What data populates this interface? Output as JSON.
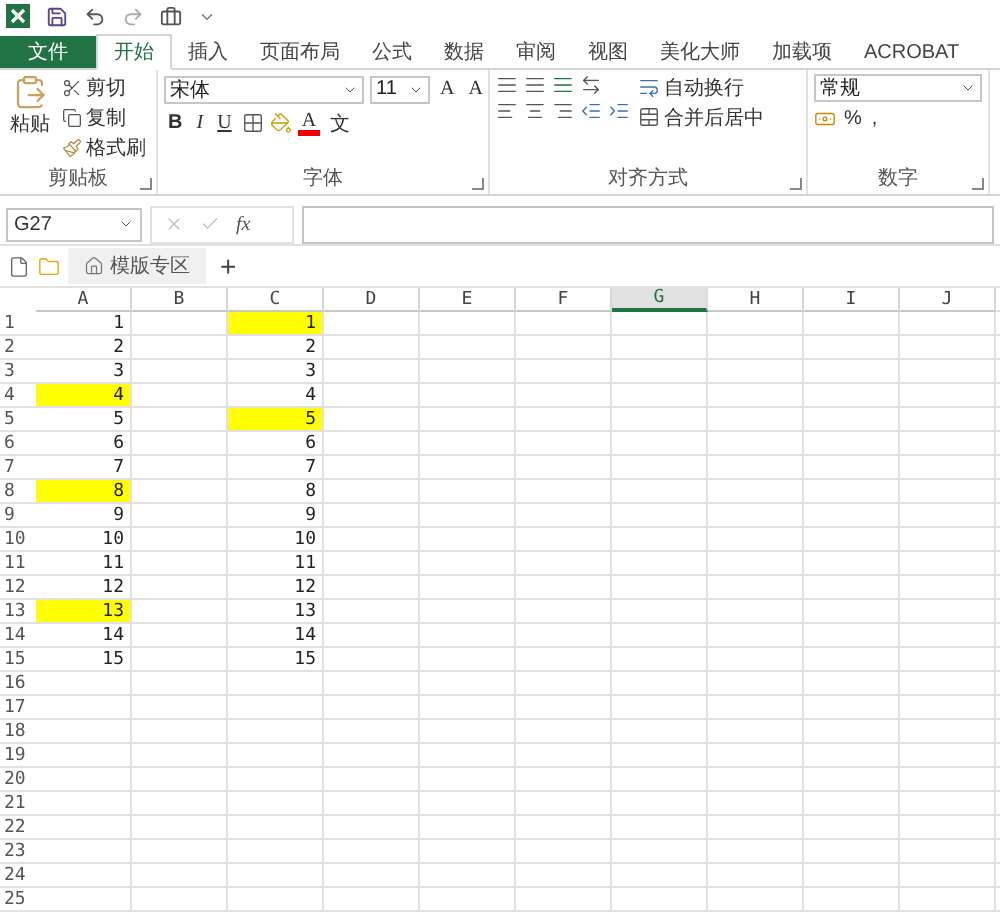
{
  "ribbon_tabs": [
    {
      "label": "文件",
      "kind": "file",
      "selected": false
    },
    {
      "label": "开始",
      "kind": "tab",
      "selected": true
    },
    {
      "label": "插入",
      "kind": "tab",
      "selected": false
    },
    {
      "label": "页面布局",
      "kind": "tab",
      "selected": false
    },
    {
      "label": "公式",
      "kind": "tab",
      "selected": false
    },
    {
      "label": "数据",
      "kind": "tab",
      "selected": false
    },
    {
      "label": "审阅",
      "kind": "tab",
      "selected": false
    },
    {
      "label": "视图",
      "kind": "tab",
      "selected": false
    },
    {
      "label": "美化大师",
      "kind": "tab",
      "selected": false
    },
    {
      "label": "加载项",
      "kind": "tab",
      "selected": false
    },
    {
      "label": "ACROBAT",
      "kind": "tab",
      "selected": false
    }
  ],
  "clipboard": {
    "paste": "粘贴",
    "cut": "剪切",
    "copy": "复制",
    "format_painter": "格式刷",
    "label": "剪贴板"
  },
  "font": {
    "name": "宋体",
    "size": "11",
    "grow": "A",
    "shrink": "A",
    "bold": "B",
    "italic": "I",
    "underline": "U",
    "font_color": "A",
    "phonetic": "文",
    "label": "字体"
  },
  "alignment": {
    "wrap_text": "自动换行",
    "merge_center": "合并后居中",
    "label": "对齐方式"
  },
  "number": {
    "format": "常规",
    "percent": "%",
    "comma": ",",
    "label": "数字"
  },
  "formula_bar": {
    "name_box": "G27",
    "function": "fx"
  },
  "sheet_bar": {
    "tab": "模版专区",
    "add": "+"
  },
  "columns": [
    {
      "label": "A",
      "selected": false
    },
    {
      "label": "B",
      "selected": false
    },
    {
      "label": "C",
      "selected": false
    },
    {
      "label": "D",
      "selected": false
    },
    {
      "label": "E",
      "selected": false
    },
    {
      "label": "F",
      "selected": false
    },
    {
      "label": "G",
      "selected": true
    },
    {
      "label": "H",
      "selected": false
    },
    {
      "label": "I",
      "selected": false
    },
    {
      "label": "J",
      "selected": false
    }
  ],
  "rows": [
    {
      "label": "1",
      "cell_a": {
        "value": "1",
        "highlighted": false
      },
      "cell_c": {
        "value": "1",
        "highlighted": true
      }
    },
    {
      "label": "2",
      "cell_a": {
        "value": "2",
        "highlighted": false
      },
      "cell_c": {
        "value": "2",
        "highlighted": false
      }
    },
    {
      "label": "3",
      "cell_a": {
        "value": "3",
        "highlighted": false
      },
      "cell_c": {
        "value": "3",
        "highlighted": false
      }
    },
    {
      "label": "4",
      "cell_a": {
        "value": "4",
        "highlighted": true
      },
      "cell_c": {
        "value": "4",
        "highlighted": false
      }
    },
    {
      "label": "5",
      "cell_a": {
        "value": "5",
        "highlighted": false
      },
      "cell_c": {
        "value": "5",
        "highlighted": true
      }
    },
    {
      "label": "6",
      "cell_a": {
        "value": "6",
        "highlighted": false
      },
      "cell_c": {
        "value": "6",
        "highlighted": false
      }
    },
    {
      "label": "7",
      "cell_a": {
        "value": "7",
        "highlighted": false
      },
      "cell_c": {
        "value": "7",
        "highlighted": false
      }
    },
    {
      "label": "8",
      "cell_a": {
        "value": "8",
        "highlighted": true
      },
      "cell_c": {
        "value": "8",
        "highlighted": false
      }
    },
    {
      "label": "9",
      "cell_a": {
        "value": "9",
        "highlighted": false
      },
      "cell_c": {
        "value": "9",
        "highlighted": false
      }
    },
    {
      "label": "10",
      "cell_a": {
        "value": "10",
        "highlighted": false
      },
      "cell_c": {
        "value": "10",
        "highlighted": false
      }
    },
    {
      "label": "11",
      "cell_a": {
        "value": "11",
        "highlighted": false
      },
      "cell_c": {
        "value": "11",
        "highlighted": false
      }
    },
    {
      "label": "12",
      "cell_a": {
        "value": "12",
        "highlighted": false
      },
      "cell_c": {
        "value": "12",
        "highlighted": false
      }
    },
    {
      "label": "13",
      "cell_a": {
        "value": "13",
        "highlighted": true
      },
      "cell_c": {
        "value": "13",
        "highlighted": false
      }
    },
    {
      "label": "14",
      "cell_a": {
        "value": "14",
        "highlighted": false
      },
      "cell_c": {
        "value": "14",
        "highlighted": false
      }
    },
    {
      "label": "15",
      "cell_a": {
        "value": "15",
        "highlighted": false
      },
      "cell_c": {
        "value": "15",
        "highlighted": false
      }
    },
    {
      "label": "16"
    },
    {
      "label": "17"
    },
    {
      "label": "18"
    },
    {
      "label": "19"
    },
    {
      "label": "20"
    },
    {
      "label": "21"
    },
    {
      "label": "22"
    },
    {
      "label": "23"
    },
    {
      "label": "24"
    },
    {
      "label": "25"
    }
  ]
}
